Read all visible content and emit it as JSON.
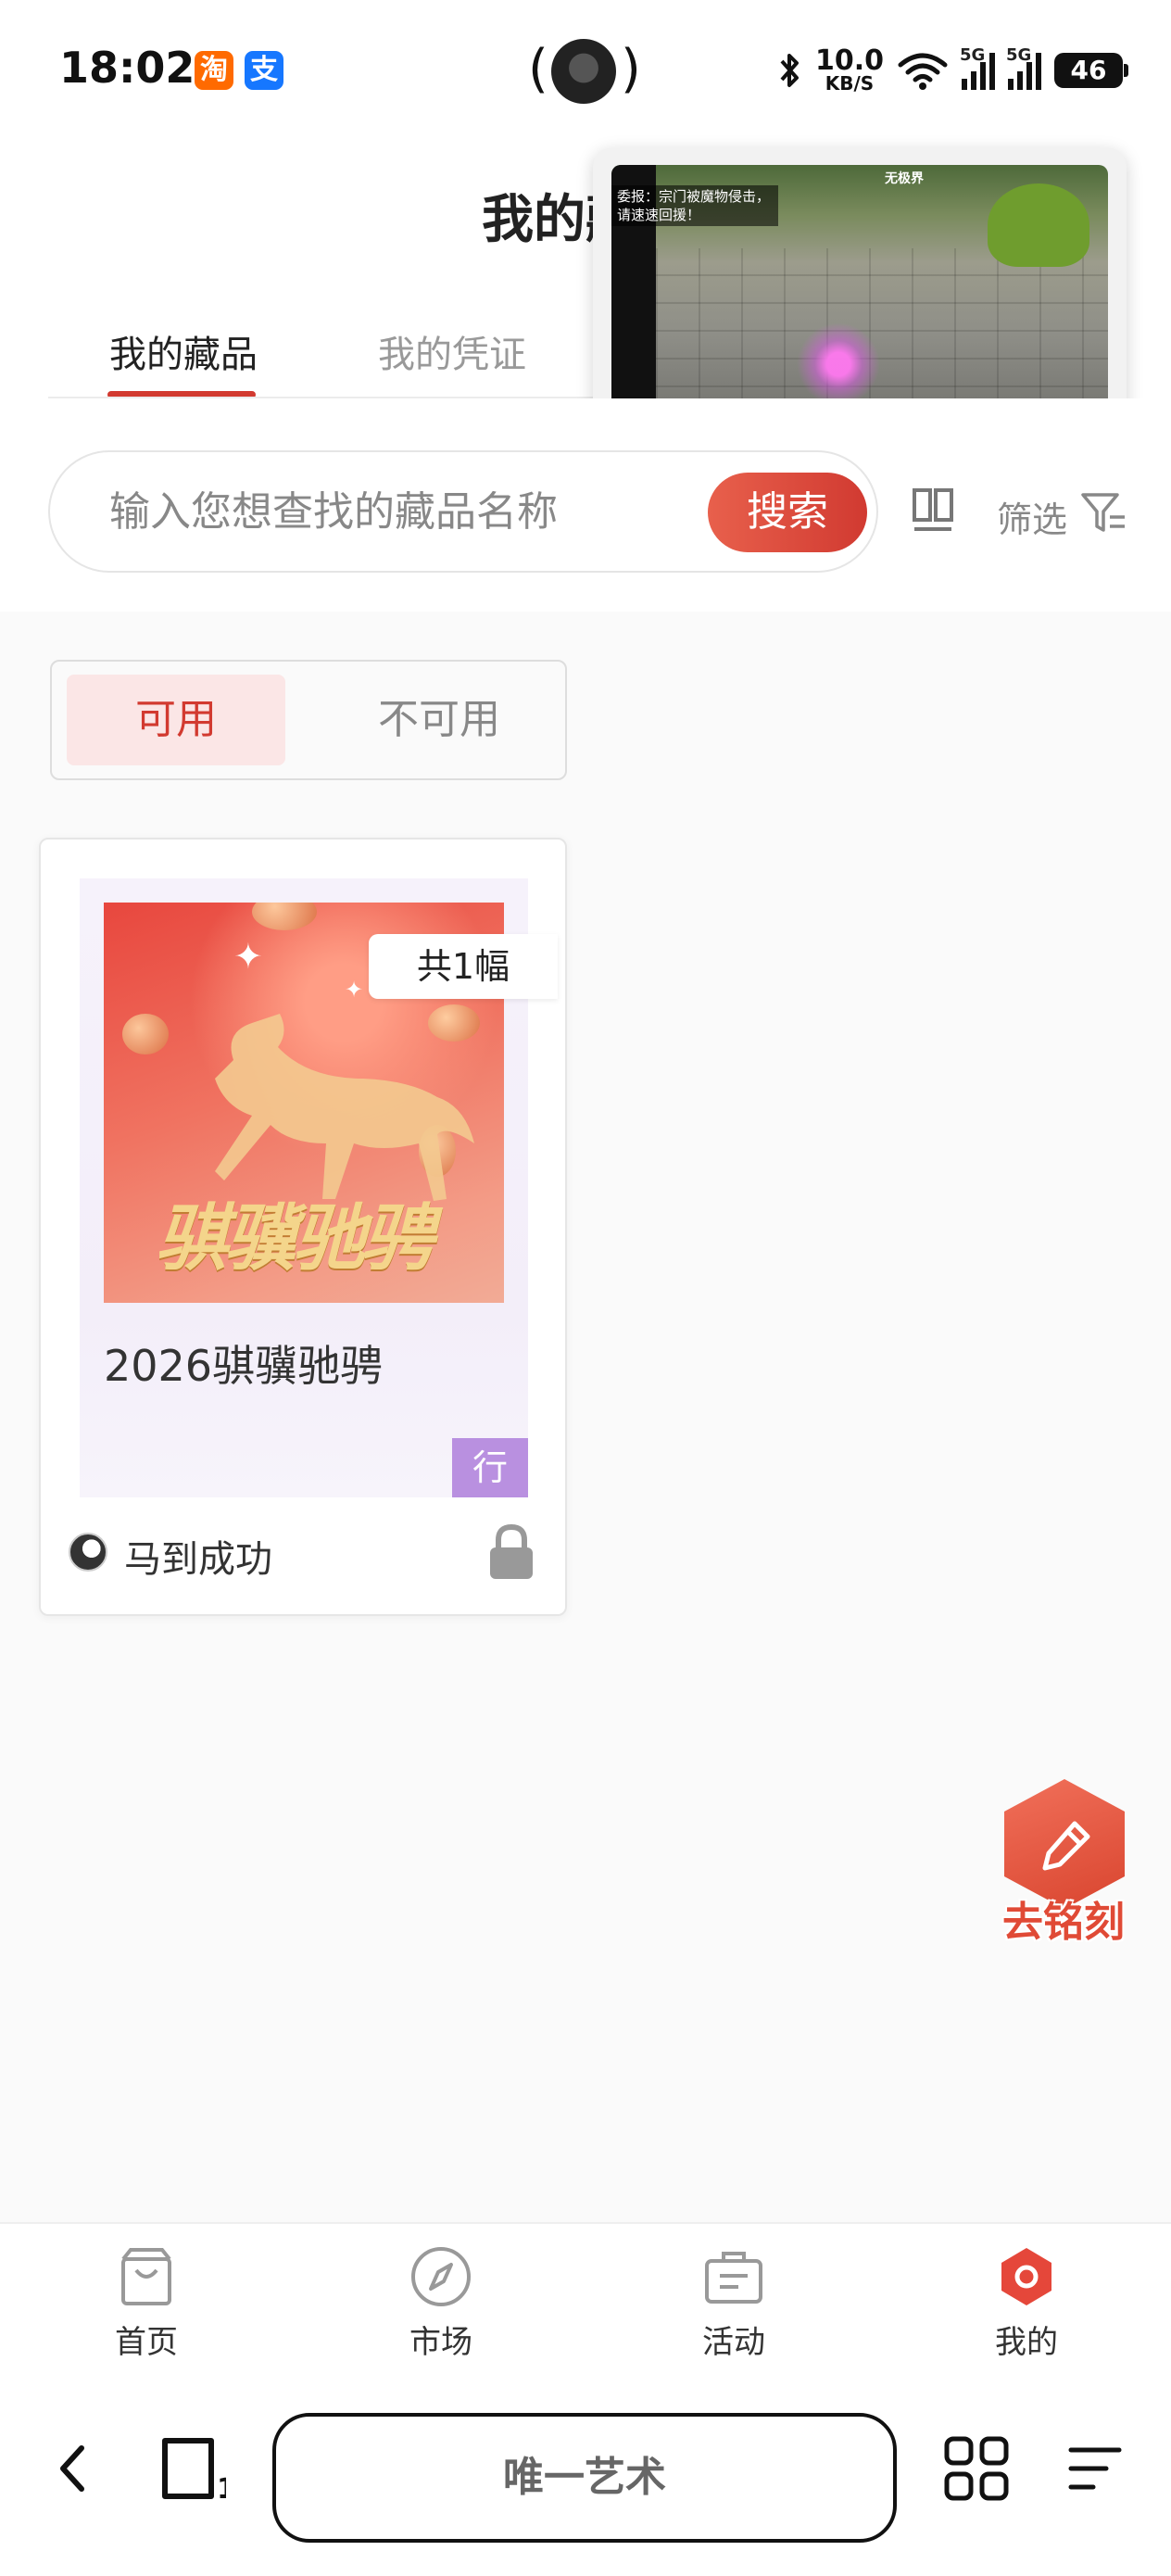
{
  "status_bar": {
    "time": "18:02",
    "apps": [
      "taobao-icon",
      "alipay-icon"
    ],
    "taobao_glyph": "淘",
    "alipay_glyph": "支",
    "net_speed_value": "10.0",
    "net_speed_unit": "KB/S",
    "sim1_label": "5G",
    "sim2_label": "5G",
    "battery": "46"
  },
  "header": {
    "title": "我的藏品"
  },
  "tabs": [
    {
      "label": "我的藏品",
      "active": true
    },
    {
      "label": "我的凭证",
      "active": false
    }
  ],
  "floating_video": {
    "overlay_text": "委报：宗门被魔物侵击，请速速回援！",
    "logo_text": "无极界"
  },
  "search": {
    "placeholder": "输入您想查找的藏品名称",
    "value": "",
    "button_label": "搜索",
    "filter_label": "筛选"
  },
  "availability_toggle": {
    "options": [
      "可用",
      "不可用"
    ],
    "selected": "可用"
  },
  "collection_cards": [
    {
      "count_badge": "共1幅",
      "image_calligraphy": "骐骥驰骋",
      "title": "2026骐骥驰骋",
      "tag": "行",
      "owner_name": "马到成功",
      "locked": true
    }
  ],
  "floating_action": {
    "label": "去铭刻",
    "icon": "pen-icon"
  },
  "bottom_nav": [
    {
      "label": "首页",
      "icon": "shopping-bag-icon",
      "active": false
    },
    {
      "label": "市场",
      "icon": "compass-icon",
      "active": false
    },
    {
      "label": "活动",
      "icon": "briefcase-icon",
      "active": false
    },
    {
      "label": "我的",
      "icon": "hexagon-profile-icon",
      "active": true
    }
  ],
  "browser_bar": {
    "url_title": "唯一艺术",
    "tab_count": "1"
  },
  "colors": {
    "accent": "#d23a30",
    "active_tab_bg": "#fbe6e6",
    "tag_purple": "#b990e0"
  }
}
